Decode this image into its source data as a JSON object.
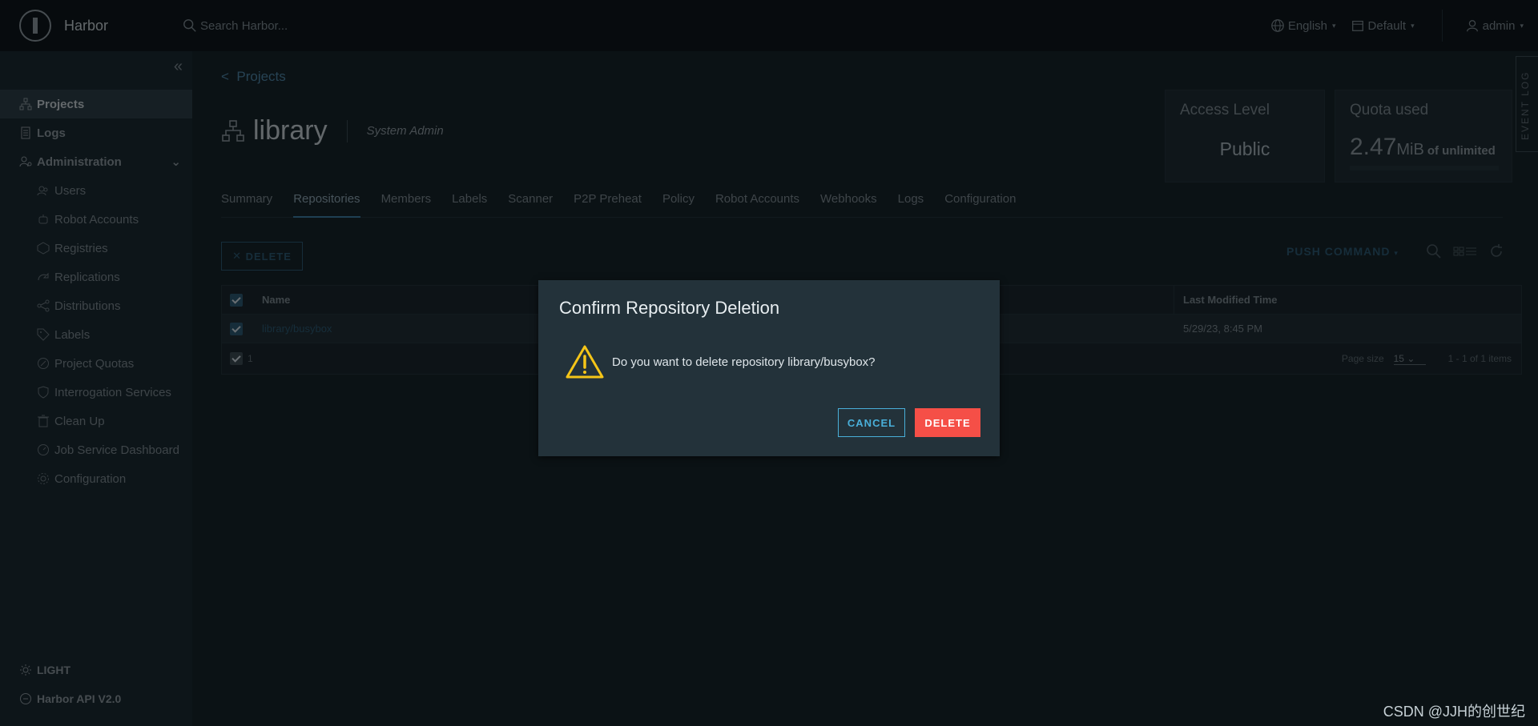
{
  "header": {
    "brand": "Harbor",
    "search_placeholder": "Search Harbor...",
    "language": "English",
    "theme_select": "Default",
    "user": "admin"
  },
  "sidebar": {
    "items": [
      {
        "label": "Projects",
        "icon": "projects-icon",
        "active": true
      },
      {
        "label": "Logs",
        "icon": "logs-icon"
      },
      {
        "label": "Administration",
        "icon": "administration-icon"
      }
    ],
    "admin_items": [
      {
        "label": "Users",
        "icon": "users-icon"
      },
      {
        "label": "Robot Accounts",
        "icon": "robot-icon"
      },
      {
        "label": "Registries",
        "icon": "registries-icon"
      },
      {
        "label": "Replications",
        "icon": "replications-icon"
      },
      {
        "label": "Distributions",
        "icon": "distributions-icon"
      },
      {
        "label": "Labels",
        "icon": "tag-icon"
      },
      {
        "label": "Project Quotas",
        "icon": "quota-icon"
      },
      {
        "label": "Interrogation Services",
        "icon": "shield-icon"
      },
      {
        "label": "Clean Up",
        "icon": "trash-icon"
      },
      {
        "label": "Job Service Dashboard",
        "icon": "dashboard-icon"
      },
      {
        "label": "Configuration",
        "icon": "gear-icon"
      }
    ],
    "theme_toggle": "LIGHT",
    "api_link": "Harbor API V2.0"
  },
  "main": {
    "breadcrumb": "Projects",
    "project_name": "library",
    "role": "System Admin",
    "access_level": {
      "title": "Access Level",
      "value": "Public"
    },
    "quota": {
      "title": "Quota used",
      "value": "2.47",
      "unit": "MiB",
      "of": "of unlimited"
    },
    "tabs": [
      "Summary",
      "Repositories",
      "Members",
      "Labels",
      "Scanner",
      "P2P Preheat",
      "Policy",
      "Robot Accounts",
      "Webhooks",
      "Logs",
      "Configuration"
    ],
    "active_tab": "Repositories",
    "delete_button": "DELETE",
    "push_command": "PUSH COMMAND",
    "table": {
      "columns": {
        "name": "Name",
        "last_modified": "Last Modified Time"
      },
      "rows": [
        {
          "name": "library/busybox",
          "last_modified": "5/29/23, 8:45 PM"
        }
      ],
      "footer": {
        "selected": "1",
        "page_size_label": "Page size",
        "page_size": "15",
        "range": "1 - 1 of 1 items"
      }
    },
    "event_log": "EVENT LOG"
  },
  "modal": {
    "title": "Confirm Repository Deletion",
    "message": "Do you want to delete repository library/busybox?",
    "cancel": "CANCEL",
    "confirm": "DELETE",
    "confirm_color": "#f54f47",
    "accent_color": "#49afd9",
    "warning_color": "#f5c518"
  },
  "watermark": "CSDN @JJH的创世纪"
}
